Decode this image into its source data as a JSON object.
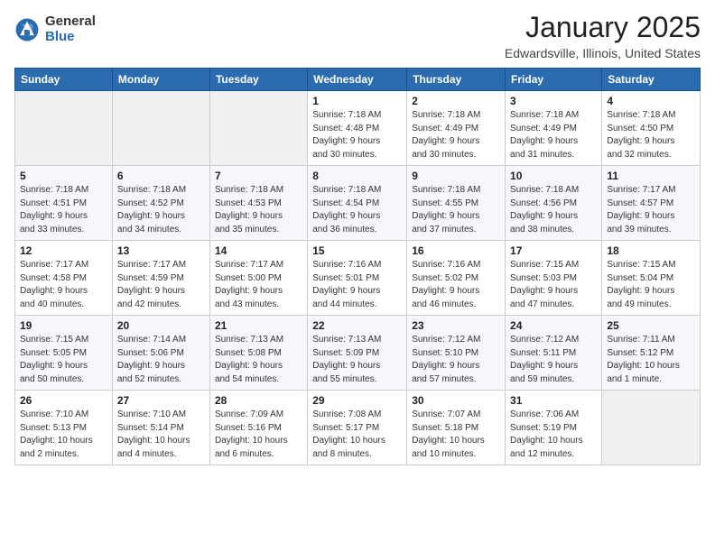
{
  "logo": {
    "general": "General",
    "blue": "Blue"
  },
  "header": {
    "month": "January 2025",
    "location": "Edwardsville, Illinois, United States"
  },
  "weekdays": [
    "Sunday",
    "Monday",
    "Tuesday",
    "Wednesday",
    "Thursday",
    "Friday",
    "Saturday"
  ],
  "weeks": [
    [
      {
        "day": "",
        "info": ""
      },
      {
        "day": "",
        "info": ""
      },
      {
        "day": "",
        "info": ""
      },
      {
        "day": "1",
        "info": "Sunrise: 7:18 AM\nSunset: 4:48 PM\nDaylight: 9 hours\nand 30 minutes."
      },
      {
        "day": "2",
        "info": "Sunrise: 7:18 AM\nSunset: 4:49 PM\nDaylight: 9 hours\nand 30 minutes."
      },
      {
        "day": "3",
        "info": "Sunrise: 7:18 AM\nSunset: 4:49 PM\nDaylight: 9 hours\nand 31 minutes."
      },
      {
        "day": "4",
        "info": "Sunrise: 7:18 AM\nSunset: 4:50 PM\nDaylight: 9 hours\nand 32 minutes."
      }
    ],
    [
      {
        "day": "5",
        "info": "Sunrise: 7:18 AM\nSunset: 4:51 PM\nDaylight: 9 hours\nand 33 minutes."
      },
      {
        "day": "6",
        "info": "Sunrise: 7:18 AM\nSunset: 4:52 PM\nDaylight: 9 hours\nand 34 minutes."
      },
      {
        "day": "7",
        "info": "Sunrise: 7:18 AM\nSunset: 4:53 PM\nDaylight: 9 hours\nand 35 minutes."
      },
      {
        "day": "8",
        "info": "Sunrise: 7:18 AM\nSunset: 4:54 PM\nDaylight: 9 hours\nand 36 minutes."
      },
      {
        "day": "9",
        "info": "Sunrise: 7:18 AM\nSunset: 4:55 PM\nDaylight: 9 hours\nand 37 minutes."
      },
      {
        "day": "10",
        "info": "Sunrise: 7:18 AM\nSunset: 4:56 PM\nDaylight: 9 hours\nand 38 minutes."
      },
      {
        "day": "11",
        "info": "Sunrise: 7:17 AM\nSunset: 4:57 PM\nDaylight: 9 hours\nand 39 minutes."
      }
    ],
    [
      {
        "day": "12",
        "info": "Sunrise: 7:17 AM\nSunset: 4:58 PM\nDaylight: 9 hours\nand 40 minutes."
      },
      {
        "day": "13",
        "info": "Sunrise: 7:17 AM\nSunset: 4:59 PM\nDaylight: 9 hours\nand 42 minutes."
      },
      {
        "day": "14",
        "info": "Sunrise: 7:17 AM\nSunset: 5:00 PM\nDaylight: 9 hours\nand 43 minutes."
      },
      {
        "day": "15",
        "info": "Sunrise: 7:16 AM\nSunset: 5:01 PM\nDaylight: 9 hours\nand 44 minutes."
      },
      {
        "day": "16",
        "info": "Sunrise: 7:16 AM\nSunset: 5:02 PM\nDaylight: 9 hours\nand 46 minutes."
      },
      {
        "day": "17",
        "info": "Sunrise: 7:15 AM\nSunset: 5:03 PM\nDaylight: 9 hours\nand 47 minutes."
      },
      {
        "day": "18",
        "info": "Sunrise: 7:15 AM\nSunset: 5:04 PM\nDaylight: 9 hours\nand 49 minutes."
      }
    ],
    [
      {
        "day": "19",
        "info": "Sunrise: 7:15 AM\nSunset: 5:05 PM\nDaylight: 9 hours\nand 50 minutes."
      },
      {
        "day": "20",
        "info": "Sunrise: 7:14 AM\nSunset: 5:06 PM\nDaylight: 9 hours\nand 52 minutes."
      },
      {
        "day": "21",
        "info": "Sunrise: 7:13 AM\nSunset: 5:08 PM\nDaylight: 9 hours\nand 54 minutes."
      },
      {
        "day": "22",
        "info": "Sunrise: 7:13 AM\nSunset: 5:09 PM\nDaylight: 9 hours\nand 55 minutes."
      },
      {
        "day": "23",
        "info": "Sunrise: 7:12 AM\nSunset: 5:10 PM\nDaylight: 9 hours\nand 57 minutes."
      },
      {
        "day": "24",
        "info": "Sunrise: 7:12 AM\nSunset: 5:11 PM\nDaylight: 9 hours\nand 59 minutes."
      },
      {
        "day": "25",
        "info": "Sunrise: 7:11 AM\nSunset: 5:12 PM\nDaylight: 10 hours\nand 1 minute."
      }
    ],
    [
      {
        "day": "26",
        "info": "Sunrise: 7:10 AM\nSunset: 5:13 PM\nDaylight: 10 hours\nand 2 minutes."
      },
      {
        "day": "27",
        "info": "Sunrise: 7:10 AM\nSunset: 5:14 PM\nDaylight: 10 hours\nand 4 minutes."
      },
      {
        "day": "28",
        "info": "Sunrise: 7:09 AM\nSunset: 5:16 PM\nDaylight: 10 hours\nand 6 minutes."
      },
      {
        "day": "29",
        "info": "Sunrise: 7:08 AM\nSunset: 5:17 PM\nDaylight: 10 hours\nand 8 minutes."
      },
      {
        "day": "30",
        "info": "Sunrise: 7:07 AM\nSunset: 5:18 PM\nDaylight: 10 hours\nand 10 minutes."
      },
      {
        "day": "31",
        "info": "Sunrise: 7:06 AM\nSunset: 5:19 PM\nDaylight: 10 hours\nand 12 minutes."
      },
      {
        "day": "",
        "info": ""
      }
    ]
  ]
}
